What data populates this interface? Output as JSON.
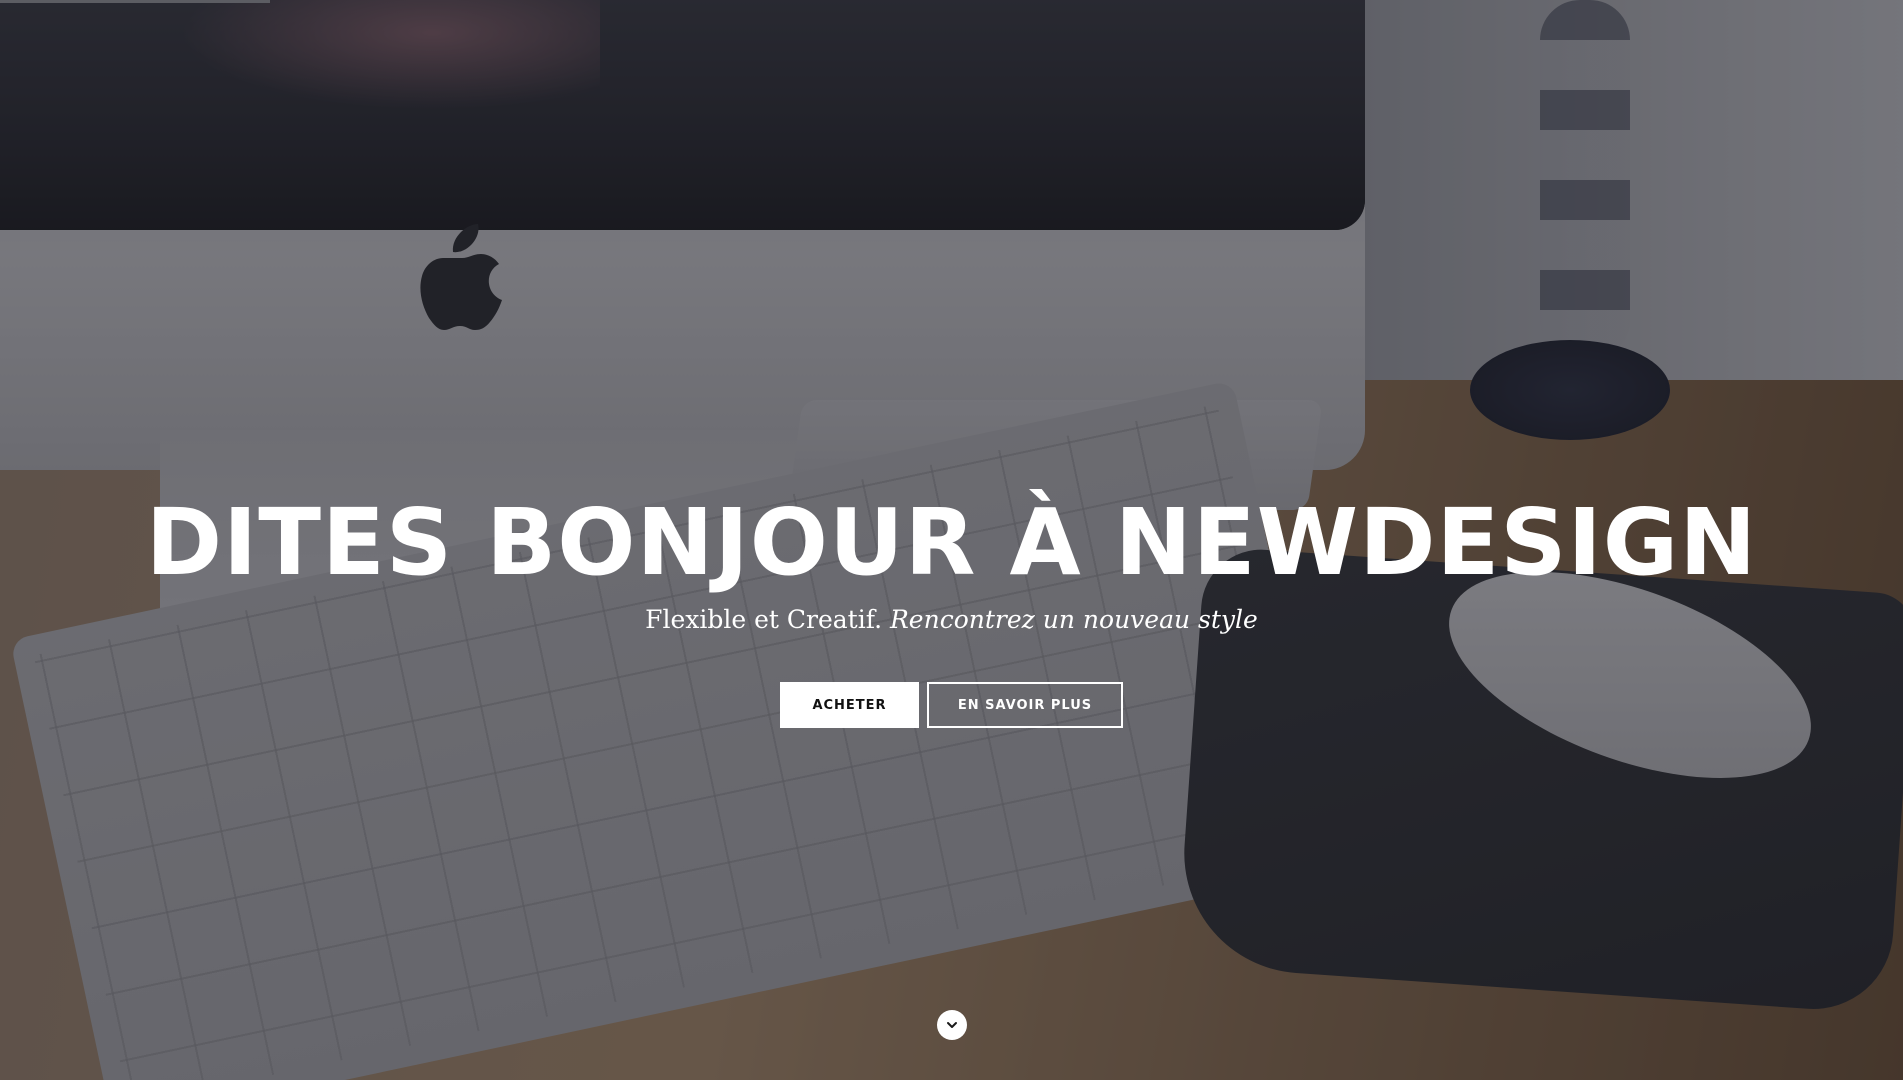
{
  "hero": {
    "title": "DITES BONJOUR À NEWDESIGN",
    "subtitle_plain": "Flexible et Creatif.",
    "subtitle_italic": "Rencontrez un nouveau style",
    "primary_button_label": "ACHETER",
    "secondary_button_label": "EN SAVOIR PLUS",
    "scroll_icon": "chevron-down-icon"
  },
  "colors": {
    "text": "#ffffff",
    "primary_button_bg": "#ffffff",
    "primary_button_text": "#111111",
    "overlay": "#28283073"
  }
}
